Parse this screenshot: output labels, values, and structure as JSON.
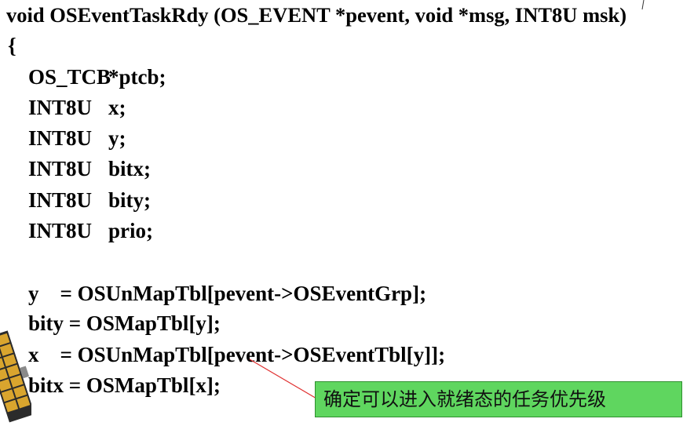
{
  "code": {
    "signature": "void OSEventTaskRdy (OS_EVENT *pevent, void *msg, INT8U msk)",
    "open_brace": "{",
    "declarations": [
      {
        "type": "OS_TCB",
        "name": "*ptcb;"
      },
      {
        "type": "INT8U",
        "name": "x;"
      },
      {
        "type": "INT8U",
        "name": "y;"
      },
      {
        "type": "INT8U",
        "name": "bitx;"
      },
      {
        "type": "INT8U",
        "name": "bity;"
      },
      {
        "type": "INT8U",
        "name": "prio;"
      }
    ],
    "statements": [
      "y    = OSUnMapTbl[pevent->OSEventGrp];",
      "bity = OSMapTbl[y];",
      "x    = OSUnMapTbl[pevent->OSEventTbl[y]];",
      "bitx = OSMapTbl[x];"
    ]
  },
  "callout": {
    "text": "确定可以进入就绪态的任务优先级",
    "fill_color": "#5fd65f",
    "pointer_color": "#e03030"
  },
  "decoration": {
    "icon": "satellite-icon"
  }
}
